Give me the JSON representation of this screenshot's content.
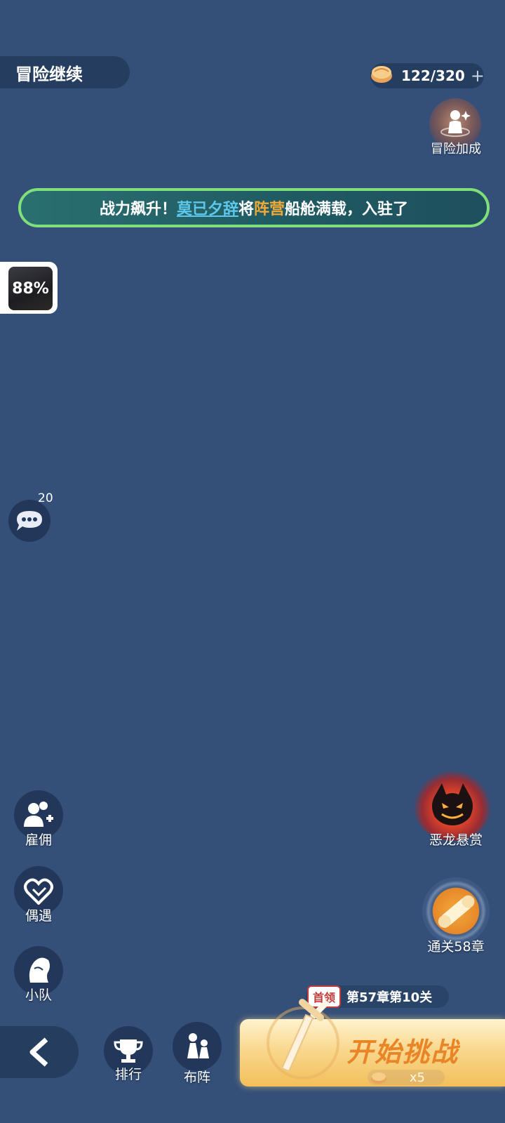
{
  "header": {
    "title": "冒险继续",
    "stamina": "122/320",
    "stamina_plus": "+"
  },
  "bonus": {
    "label": "冒险加成"
  },
  "banner": {
    "prefix": "战力飙升！",
    "player": "莫已夕辞",
    "mid": "将",
    "camp": "阵营",
    "suffix": "船舱满载，入驻了"
  },
  "progress": {
    "percent": "88%"
  },
  "chat": {
    "count": "20"
  },
  "left_menu": {
    "hire": "雇佣",
    "encounter": "偶遇",
    "team": "小队"
  },
  "right_menu": {
    "dragon": "恶龙悬赏",
    "chapter": "通关58章"
  },
  "stage": {
    "first_badge": "首领",
    "name": "第57章第10关"
  },
  "bottom": {
    "rank": "排行",
    "formation": "布阵",
    "start": "开始挑战",
    "cost": "x5"
  },
  "colors": {
    "background": "#344f78",
    "accent_orange": "#e98526",
    "banner_border": "#7fe07a",
    "player_name": "#5ec7ec",
    "camp": "#f6a936"
  }
}
